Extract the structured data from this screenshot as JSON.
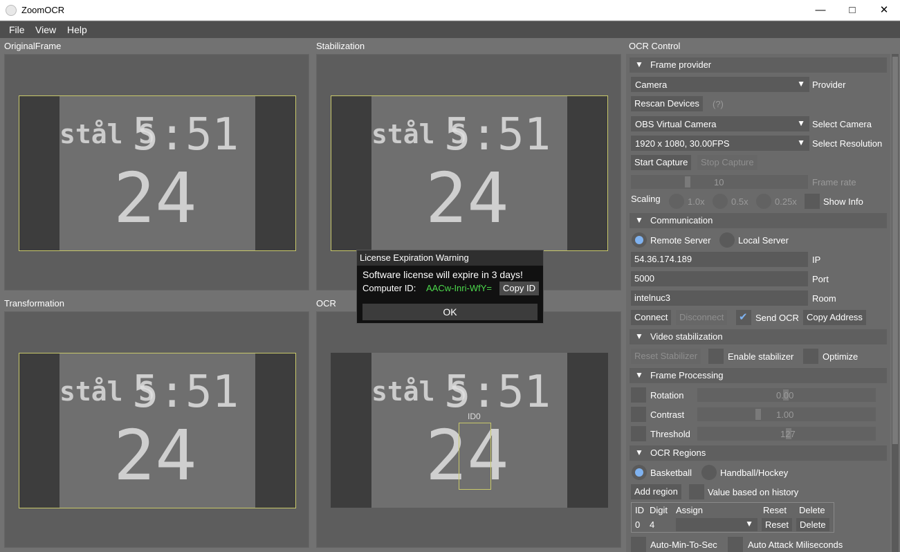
{
  "window": {
    "title": "ZoomOCR"
  },
  "menu": {
    "file": "File",
    "view": "View",
    "help": "Help"
  },
  "panels": {
    "original": "OriginalFrame",
    "stabilization": "Stabilization",
    "transformation": "Transformation",
    "ocr": "OCR",
    "control": "OCR Control"
  },
  "scoreboard": {
    "time": "5:51",
    "shot": "24",
    "left_text": "stål S",
    "region_label": "ID0"
  },
  "frame_provider": {
    "section": "Frame provider",
    "provider_value": "Camera",
    "provider_label": "Provider",
    "rescan": "Rescan Devices",
    "help": "(?)",
    "camera_value": "OBS Virtual Camera",
    "camera_label": "Select Camera",
    "resolution_value": "1920 x 1080, 30.00FPS",
    "resolution_label": "Select Resolution",
    "start": "Start Capture",
    "stop": "Stop Capture",
    "framerate_value": "10",
    "framerate_label": "Frame rate",
    "scaling_label": "Scaling",
    "scale_1": "1.0x",
    "scale_05": "0.5x",
    "scale_025": "0.25x",
    "show_info": "Show Info"
  },
  "communication": {
    "section": "Communication",
    "remote": "Remote Server",
    "local": "Local Server",
    "ip_value": "54.36.174.189",
    "ip_label": "IP",
    "port_value": "5000",
    "port_label": "Port",
    "room_value": "intelnuc3",
    "room_label": "Room",
    "connect": "Connect",
    "disconnect": "Disconnect",
    "send_ocr": "Send OCR",
    "copy_address": "Copy Address"
  },
  "stabilization": {
    "section": "Video stabilization",
    "reset": "Reset Stabilizer",
    "enable": "Enable stabilizer",
    "optimize": "Optimize"
  },
  "processing": {
    "section": "Frame Processing",
    "rotation": "Rotation",
    "rotation_value": "0.00",
    "contrast": "Contrast",
    "contrast_value": "1.00",
    "threshold": "Threshold",
    "threshold_value": "127"
  },
  "regions": {
    "section": "OCR Regions",
    "basketball": "Basketball",
    "handball": "Handball/Hockey",
    "add": "Add region",
    "history": "Value based on history",
    "col_id": "ID",
    "col_digit": "Digit",
    "col_assign": "Assign",
    "col_reset": "Reset",
    "col_delete": "Delete",
    "row_id": "0",
    "row_digit": "4",
    "row_reset": "Reset",
    "row_delete": "Delete",
    "auto_min": "Auto-Min-To-Sec",
    "auto_attack": "Auto Attack Miliseconds"
  },
  "dialog": {
    "title": "License Expiration Warning",
    "message": "Software license will expire in 3 days!",
    "cid_label": "Computer ID:",
    "cid_value": "AACw-Inri-WfY=",
    "copy": "Copy ID",
    "ok": "OK"
  },
  "colors": {
    "accent": "#7fb2f0",
    "cid": "#4cd94c",
    "outline": "#c9c96a"
  }
}
